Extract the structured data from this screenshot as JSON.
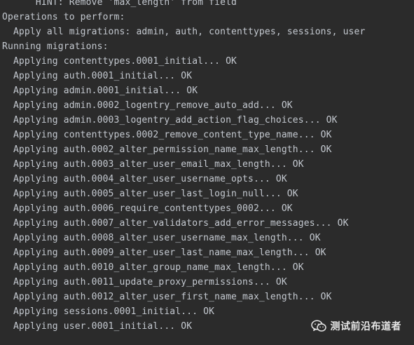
{
  "terminal": {
    "lines": [
      "      HINT: Remove 'max_length' from field",
      "Operations to perform:",
      "  Apply all migrations: admin, auth, contenttypes, sessions, user",
      "Running migrations:",
      "  Applying contenttypes.0001_initial... OK",
      "  Applying auth.0001_initial... OK",
      "  Applying admin.0001_initial... OK",
      "  Applying admin.0002_logentry_remove_auto_add... OK",
      "  Applying admin.0003_logentry_add_action_flag_choices... OK",
      "  Applying contenttypes.0002_remove_content_type_name... OK",
      "  Applying auth.0002_alter_permission_name_max_length... OK",
      "  Applying auth.0003_alter_user_email_max_length... OK",
      "  Applying auth.0004_alter_user_username_opts... OK",
      "  Applying auth.0005_alter_user_last_login_null... OK",
      "  Applying auth.0006_require_contenttypes_0002... OK",
      "  Applying auth.0007_alter_validators_add_error_messages... OK",
      "  Applying auth.0008_alter_user_username_max_length... OK",
      "  Applying auth.0009_alter_user_last_name_max_length... OK",
      "  Applying auth.0010_alter_group_name_max_length... OK",
      "  Applying auth.0011_update_proxy_permissions... OK",
      "  Applying auth.0012_alter_user_first_name_max_length... OK",
      "  Applying sessions.0001_initial... OK",
      "  Applying user.0001_initial... OK"
    ]
  },
  "watermark": {
    "text": "测试前沿布道者",
    "icon": "wechat-icon"
  },
  "colors": {
    "background": "#2b2b2b",
    "text": "#c4c9d0"
  }
}
